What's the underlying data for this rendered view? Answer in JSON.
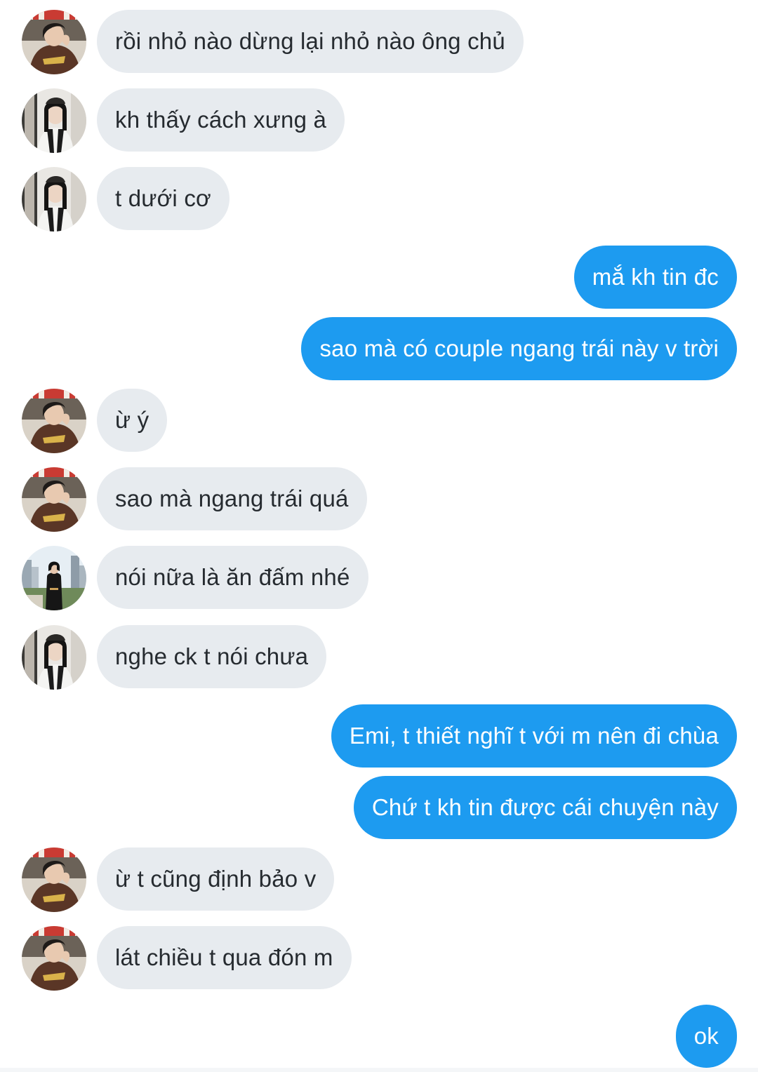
{
  "colors": {
    "incoming_bubble": "#e7ebef",
    "outgoing_bubble": "#1d9bf0",
    "incoming_text": "#262b30",
    "outgoing_text": "#ffffff"
  },
  "messages": [
    {
      "side": "incoming",
      "avatar": "user-a",
      "text": "rồi nhỏ nào dừng lại nhỏ nào ông chủ"
    },
    {
      "side": "incoming",
      "avatar": "user-b",
      "text": "kh thấy cách xưng à"
    },
    {
      "side": "incoming",
      "avatar": "user-b",
      "text": "t dưới cơ"
    },
    {
      "side": "outgoing",
      "text": "mắ kh tin đc"
    },
    {
      "side": "outgoing",
      "text": "sao mà có couple ngang trái này v trời"
    },
    {
      "side": "incoming",
      "avatar": "user-a",
      "text": "ừ ý"
    },
    {
      "side": "incoming",
      "avatar": "user-a",
      "text": "sao mà ngang trái quá"
    },
    {
      "side": "incoming",
      "avatar": "user-c",
      "text": "nói nữa là ăn đấm nhé"
    },
    {
      "side": "incoming",
      "avatar": "user-b",
      "text": "nghe ck t nói chưa"
    },
    {
      "side": "outgoing",
      "text": "Emi, t thiết nghĩ t với m nên đi chùa"
    },
    {
      "side": "outgoing",
      "text": "Chứ t kh tin được cái chuyện này"
    },
    {
      "side": "incoming",
      "avatar": "user-a",
      "text": "ừ t cũng định bảo v"
    },
    {
      "side": "incoming",
      "avatar": "user-a",
      "text": "lát chiều t qua đón m"
    },
    {
      "side": "outgoing",
      "text": "ok"
    }
  ]
}
